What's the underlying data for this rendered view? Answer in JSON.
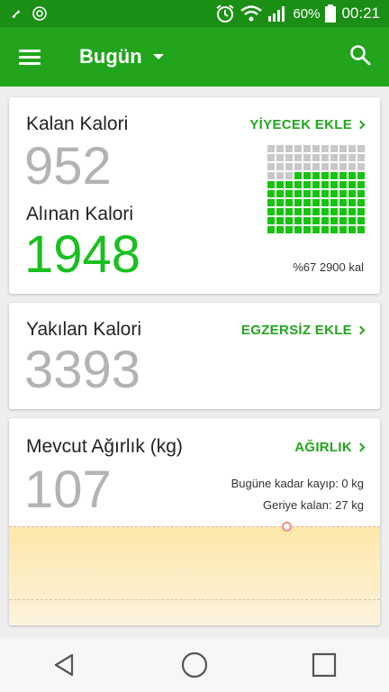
{
  "status_bar": {
    "battery": "60%",
    "time": "00:21"
  },
  "app_bar": {
    "title": "Bugün"
  },
  "calories": {
    "remaining_label": "Kalan Kalori",
    "remaining_value": "952",
    "consumed_label": "Alınan Kalori",
    "consumed_value": "1948",
    "add_food_label": "YİYECEK EKLE",
    "progress_text": "%67 2900 kal",
    "progress_fraction": 0.67
  },
  "burned": {
    "label": "Yakılan Kalori",
    "value": "3393",
    "add_exercise_label": "EGZERSİZ EKLE"
  },
  "weight": {
    "label": "Mevcut Ağırlık (kg)",
    "value": "107",
    "action_label": "AĞIRLIK",
    "lost_text": "Bugüne kadar kayıp: 0 kg",
    "remaining_text": "Geriye kalan: 27 kg"
  },
  "colors": {
    "primary": "#22a51c",
    "status_bar": "#1b8e16",
    "accent_green": "#19c01f"
  }
}
